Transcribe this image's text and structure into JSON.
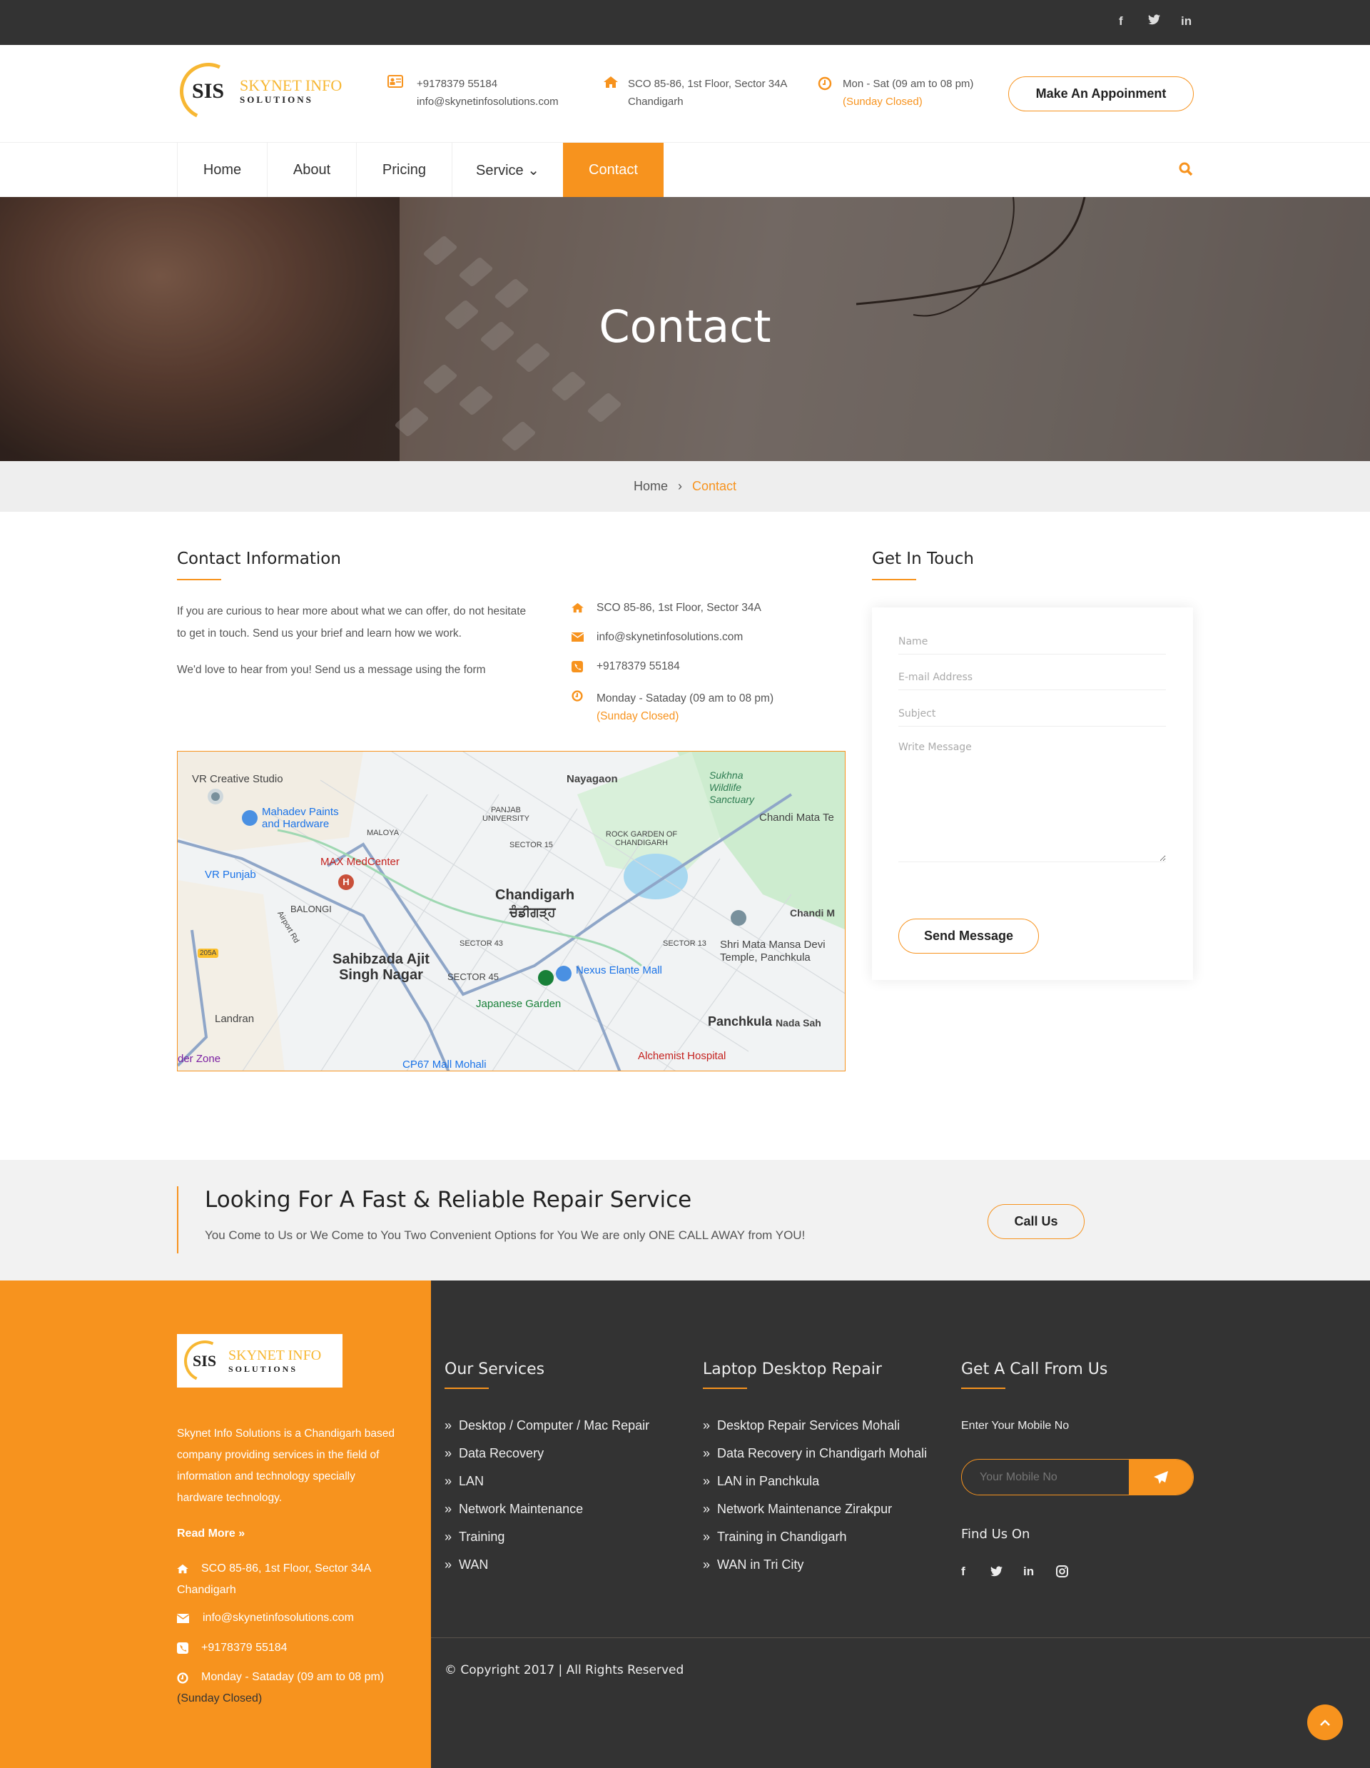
{
  "topbar": {
    "social": [
      "facebook-icon",
      "twitter-icon",
      "linkedin-icon"
    ],
    "social_glyphs": [
      "f",
      "🐦",
      "in"
    ]
  },
  "brand": {
    "sis": "SIS",
    "line1": "SKYNET INFO",
    "line2": "SOLUTIONS"
  },
  "header": {
    "phone": "+9178379 55184",
    "email": "info@skynetinfosolutions.com",
    "address_line1": "SCO 85-86, 1st Floor, Sector 34A",
    "address_line2": "Chandigarh",
    "hours": "Mon - Sat (09 am to 08 pm)",
    "hours_note": "(Sunday Closed)",
    "cta_button": "Make An Appoinment"
  },
  "nav": {
    "items": [
      {
        "label": "Home"
      },
      {
        "label": "About"
      },
      {
        "label": "Pricing"
      },
      {
        "label": "Service ⌄"
      },
      {
        "label": "Contact",
        "active": true
      }
    ]
  },
  "hero": {
    "title": "Contact"
  },
  "breadcrumb": {
    "home": "Home",
    "sep": "›",
    "current": "Contact"
  },
  "contact_info": {
    "title": "Contact Information",
    "para1_line1": "If you are curious to hear more about what we can offer, do not hesitate",
    "para1_line2": "to get in touch. Send us your brief and learn how we work.",
    "para2": "We'd love to hear from you! Send us a message using the form",
    "address": "SCO 85-86, 1st Floor, Sector 34A",
    "email": "info@skynetinfosolutions.com",
    "phone": "+9178379 55184",
    "hours": "Monday - Sataday (09 am to 08 pm)",
    "hours_note": "(Sunday Closed)"
  },
  "map": {
    "labels": [
      "VR Creative Studio",
      "Mahadev Paints and Hardware",
      "MALOYA",
      "PANJAB UNIVERSITY",
      "Nayagaon",
      "Sukhna Wildlife Sanctuary",
      "Chandi Mata Te",
      "ROCK GARDEN OF CHANDIGARH",
      "SECTOR 15",
      "MAX MedCenter",
      "VR Punjab",
      "BALONGI",
      "Chandigarh",
      "ਚੰਡੀਗੜ੍ਹ",
      "SECTOR 43",
      "SECTOR 13",
      "Shri Mata Mansa Devi Temple, Panchkula",
      "Sahibzada Ajit Singh Nagar",
      "SECTOR 45",
      "Nexus Elante Mall",
      "Japanese Garden",
      "Landran",
      "Panchkula",
      "Nada Sah",
      "Alchemist Hospital",
      "Chandi M",
      "der Zone",
      "CP67 Mall Mohali",
      "205A",
      "Airport Rd"
    ]
  },
  "form": {
    "title": "Get In Touch",
    "name_placeholder": "Name",
    "email_placeholder": "E-mail Address",
    "subject_placeholder": "Subject",
    "message_placeholder": "Write Message",
    "submit": "Send Message"
  },
  "cta": {
    "title": "Looking For A Fast & Reliable Repair Service",
    "subtitle": "You Come to Us or We Come to You Two Convenient Options for You We are only ONE CALL AWAY from YOU!",
    "button": "Call Us"
  },
  "footer": {
    "about": [
      "Skynet Info Solutions is a Chandigarh based",
      "company providing services in the field of",
      "information and technology specially",
      "hardware technology."
    ],
    "read_more": "Read More  »",
    "address_line1": "SCO 85-86, 1st Floor, Sector 34A",
    "address_line2": "Chandigarh",
    "email": "info@skynetinfosolutions.com",
    "phone": "+9178379 55184",
    "hours": "Monday - Sataday (09 am to 08 pm)",
    "hours_note": "(Sunday Closed)",
    "services_title": "Our Services",
    "services": [
      "Desktop / Computer / Mac Repair",
      "Data Recovery",
      "LAN",
      "Network Maintenance",
      "Training",
      "WAN"
    ],
    "repair_title": "Laptop Desktop Repair",
    "repair": [
      "Desktop Repair Services Mohali",
      "Data Recovery in Chandigarh Mohali",
      "LAN in Panchkula",
      "Network Maintenance Zirakpur",
      "Training in Chandigarh",
      "WAN in Tri City"
    ],
    "call_title": "Get A Call From Us",
    "mobile_label": "Enter Your Mobile No",
    "mobile_placeholder": "Your Mobile No",
    "find_us": "Find Us On",
    "copyright": "© Copyright 2017 | All Rights Reserved"
  },
  "colors": {
    "accent": "#f7931e",
    "dark": "#333333",
    "light_band": "#f2f2f2"
  }
}
